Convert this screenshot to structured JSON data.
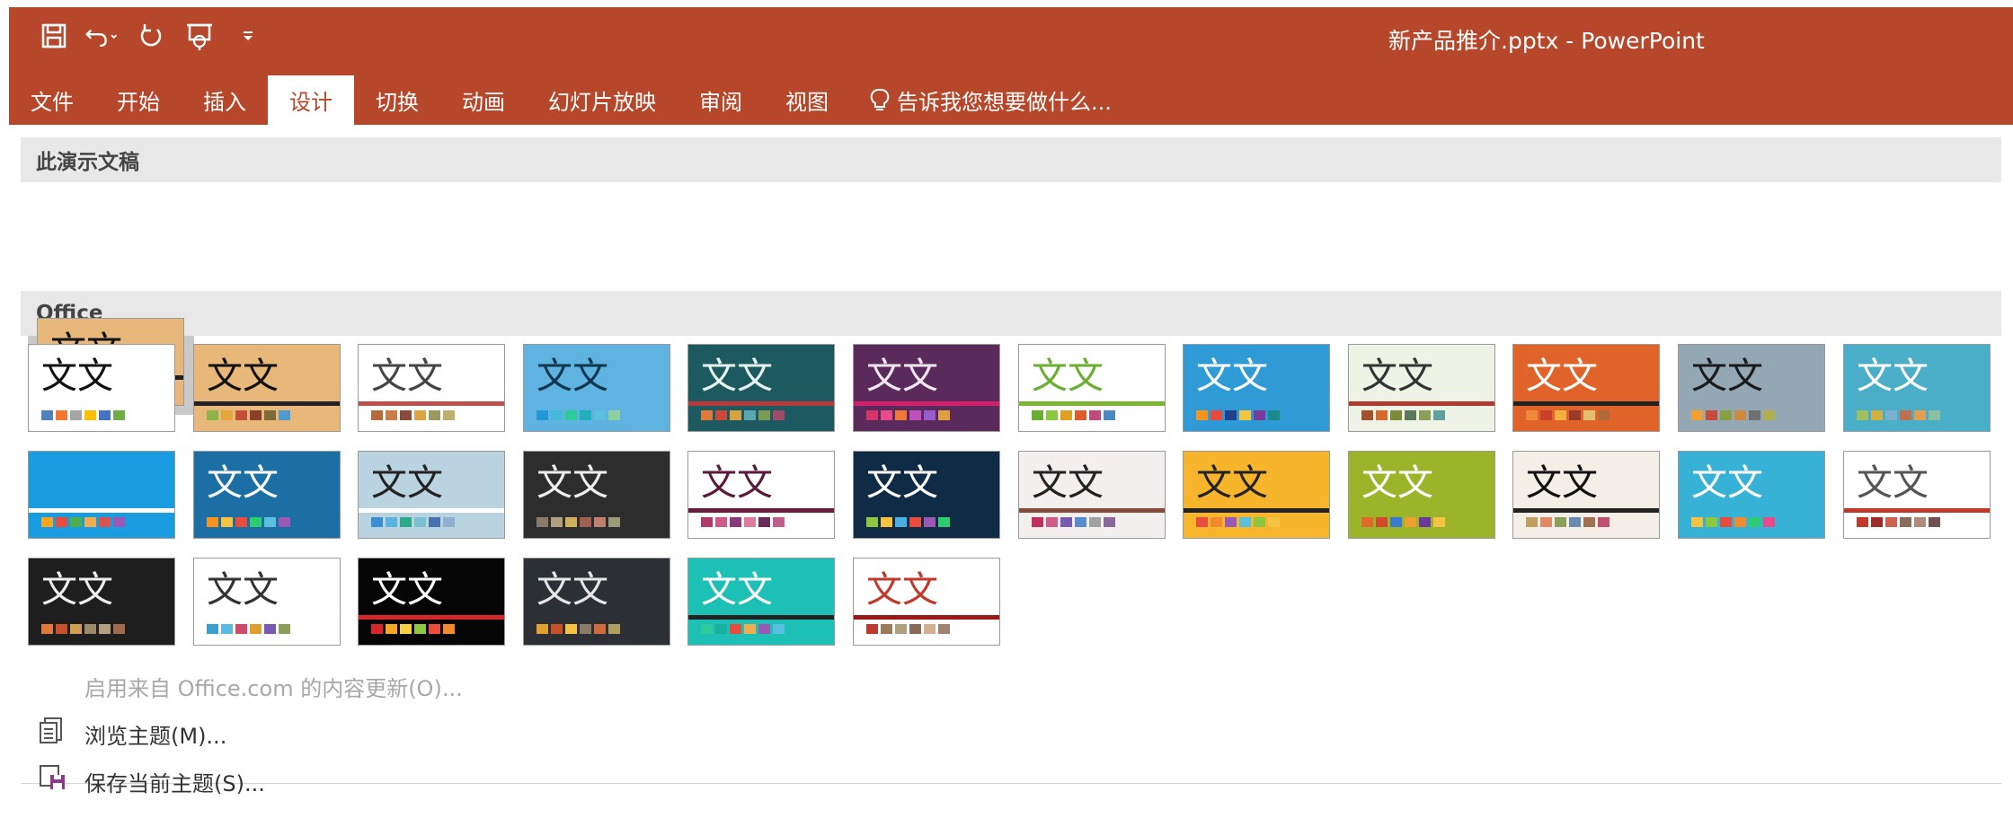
{
  "window": {
    "title": "新产品推介.pptx - PowerPoint"
  },
  "quick_access": [
    {
      "name": "save-icon"
    },
    {
      "name": "undo-icon"
    },
    {
      "name": "redo-icon"
    },
    {
      "name": "presentation-icon"
    },
    {
      "name": "customize-qat-icon"
    }
  ],
  "tabs": [
    {
      "label": "文件",
      "active": false
    },
    {
      "label": "开始",
      "active": false
    },
    {
      "label": "插入",
      "active": false
    },
    {
      "label": "设计",
      "active": true
    },
    {
      "label": "切换",
      "active": false
    },
    {
      "label": "动画",
      "active": false
    },
    {
      "label": "幻灯片放映",
      "active": false
    },
    {
      "label": "审阅",
      "active": false
    },
    {
      "label": "视图",
      "active": false
    }
  ],
  "tell_me": {
    "label": "告诉我您想要做什么..."
  },
  "sections": {
    "this_presentation": "此演示文稿",
    "office": "Office"
  },
  "thumb_text": "文文",
  "current_theme": {
    "text": "文文",
    "bg": "#e8b87a",
    "fg": "#111111",
    "bar": "#222222",
    "swatches": [
      "#8db34a",
      "#e2a63a",
      "#e0c53a",
      "#c2497f",
      "#8a67b0",
      "#4d9bd1",
      "#8fb05a"
    ]
  },
  "themes": [
    {
      "bg": "#ffffff",
      "fg": "#111111",
      "bar": "",
      "swatches": [
        "#4f81bd",
        "#f07830",
        "#a5a5a5",
        "#ffc000",
        "#4472c4",
        "#70ad47"
      ]
    },
    {
      "bg": "#e8b87a",
      "fg": "#111111",
      "bar": "#222222",
      "swatches": [
        "#8db34a",
        "#e2a63a",
        "#c24f38",
        "#8a3f2a",
        "#7f6b3a",
        "#4d9bd1"
      ]
    },
    {
      "bg": "#ffffff",
      "fg": "#444444",
      "bar": "#c0504d",
      "swatches": [
        "#b66a3a",
        "#c97e4a",
        "#8a4a3a",
        "#d9a441",
        "#9a9a60",
        "#c0b070"
      ]
    },
    {
      "bg": "#5fb3e0",
      "fg": "#10354f",
      "bar": "",
      "swatches": [
        "#1f9ad6",
        "#46b9d8",
        "#2ecc9a",
        "#1fb0c0",
        "#5bc0de",
        "#8fd0a0"
      ]
    },
    {
      "bg": "#1d5a5f",
      "fg": "#e8f3f3",
      "bar": "#b83a3a",
      "swatches": [
        "#e07a3a",
        "#c94a3a",
        "#d9a241",
        "#5aa6b0",
        "#7d9a55",
        "#a04a6a"
      ]
    },
    {
      "bg": "#5a2a5a",
      "fg": "#f2e6f2",
      "bar": "#d0206a",
      "swatches": [
        "#d6336a",
        "#e84a8a",
        "#f07838",
        "#c050c0",
        "#9a5ad0",
        "#e0a040"
      ]
    },
    {
      "bg": "#ffffff",
      "fg": "#6aae32",
      "bar": "#7bb531",
      "swatches": [
        "#6aae32",
        "#8dc63f",
        "#e0a020",
        "#e05a2a",
        "#c04a7a",
        "#4a8ac0"
      ]
    },
    {
      "bg": "#2e9ad6",
      "fg": "#ffffff",
      "bar": "",
      "swatches": [
        "#f7941d",
        "#e94a3a",
        "#23408e",
        "#f5c542",
        "#7a3a9a",
        "#1a8a8a"
      ]
    },
    {
      "bg": "#eef3e6",
      "fg": "#333333",
      "bar": "#b03a2e",
      "swatches": [
        "#a3502c",
        "#d46b2a",
        "#7d8a3a",
        "#5a7a5a",
        "#8aa05a",
        "#60a0a0"
      ]
    },
    {
      "bg": "#e0632a",
      "fg": "#ffffff",
      "bar": "#222222",
      "swatches": [
        "#f08a3a",
        "#c8402a",
        "#f5b042",
        "#9a3a2a",
        "#e0c070",
        "#b06a3a"
      ]
    },
    {
      "bg": "#93a8b4",
      "fg": "#1a1a1a",
      "bar": "",
      "swatches": [
        "#f0a030",
        "#c84a3a",
        "#8aa040",
        "#d08a40",
        "#707070",
        "#b0b050"
      ]
    },
    {
      "bg": "#4aaec8",
      "fg": "#ffffff",
      "bar": "",
      "swatches": [
        "#a0c060",
        "#d0b040",
        "#7ab0d0",
        "#c07050",
        "#e0a050",
        "#8ac0a0"
      ]
    },
    {
      "bg": "#1a9ce0",
      "fg": "#1a9ce0",
      "bar": "#ffffff",
      "swatches": [
        "#f5a623",
        "#e94b3c",
        "#4cae4c",
        "#f0ad4e",
        "#d9534f",
        "#9b59b6"
      ]
    },
    {
      "bg": "#1b6fa5",
      "fg": "#ffffff",
      "bar": "",
      "swatches": [
        "#f7941d",
        "#f5c342",
        "#e94b3c",
        "#2ecc71",
        "#5bc0de",
        "#9b59b6"
      ]
    },
    {
      "bg": "#b9d3e0",
      "fg": "#222222",
      "bar": "#ffffff",
      "swatches": [
        "#3a8fd0",
        "#5ab3e0",
        "#2eaa8a",
        "#7ac0d0",
        "#4a70b0",
        "#90b0d0"
      ]
    },
    {
      "bg": "#2d2d2d",
      "fg": "#eeeeee",
      "bar": "",
      "swatches": [
        "#8a7a6a",
        "#b0a080",
        "#d0b060",
        "#a06050",
        "#c08070",
        "#9a9a7a"
      ]
    },
    {
      "bg": "#ffffff",
      "fg": "#5a1a3a",
      "bar": "#6a1e3e",
      "swatches": [
        "#b03a6a",
        "#d05a8a",
        "#8a3a7a",
        "#e07aa0",
        "#6a2a5a",
        "#c0608a"
      ]
    },
    {
      "bg": "#0f2b45",
      "fg": "#ffffff",
      "bar": "",
      "swatches": [
        "#8dc63f",
        "#f5c342",
        "#4ab0e0",
        "#e94b3c",
        "#9b59b6",
        "#2ecc71"
      ]
    },
    {
      "bg": "#f2efee",
      "fg": "#222222",
      "bar": "#8a4a3a",
      "swatches": [
        "#c0305a",
        "#d05a8a",
        "#7a5ab0",
        "#5a8ad0",
        "#a0a0a0",
        "#8a6a9a"
      ]
    },
    {
      "bg": "#f7b52b",
      "fg": "#222222",
      "bar": "#222222",
      "swatches": [
        "#e94b3c",
        "#f08a2a",
        "#9b59b6",
        "#5bc0de",
        "#8dc63f",
        "#f5c342"
      ]
    },
    {
      "bg": "#9bb42a",
      "fg": "#ffffff",
      "bar": "",
      "swatches": [
        "#e06a2a",
        "#d04a2a",
        "#3a7ad0",
        "#f0a030",
        "#6a3a9a",
        "#f5c342"
      ]
    },
    {
      "bg": "#f3efe6",
      "fg": "#111111",
      "bar": "#222222",
      "swatches": [
        "#c0a060",
        "#e08a6a",
        "#8aa05a",
        "#6a8ab0",
        "#a07050",
        "#c05070"
      ]
    },
    {
      "bg": "#38b1d6",
      "fg": "#ffffff",
      "bar": "",
      "swatches": [
        "#f5c342",
        "#8dc63f",
        "#e94b3c",
        "#f08a2a",
        "#2ecc71",
        "#e94b8a"
      ]
    },
    {
      "bg": "#ffffff",
      "fg": "#555555",
      "bar": "#c0392b",
      "swatches": [
        "#c0392b",
        "#a02a2a",
        "#d06050",
        "#8a6a5a",
        "#b08a7a",
        "#705050"
      ]
    },
    {
      "bg": "#1e1e1e",
      "fg": "#eeeeee",
      "bar": "",
      "swatches": [
        "#e07a3a",
        "#c8502a",
        "#d0a050",
        "#9a8a6a",
        "#b0a080",
        "#a06a4a"
      ]
    },
    {
      "bg": "#ffffff",
      "fg": "#333333",
      "bar": "",
      "swatches": [
        "#3aa0d0",
        "#5abae0",
        "#d04a6a",
        "#e0a030",
        "#7a5ab0",
        "#8aa05a"
      ]
    },
    {
      "bg": "#050505",
      "fg": "#ffffff",
      "bar": "#d7262b",
      "swatches": [
        "#d7262b",
        "#f5a623",
        "#f5d142",
        "#8dc63f",
        "#e94b3c",
        "#f08a2a"
      ]
    },
    {
      "bg": "#2c2f33",
      "fg": "#e6e6e6",
      "bar": "",
      "swatches": [
        "#e0a030",
        "#c8502a",
        "#f5c342",
        "#8a7a6a",
        "#d06a3a",
        "#b0a060"
      ]
    },
    {
      "bg": "#1cc0b4",
      "fg": "#ffffff",
      "bar": "#222222",
      "swatches": [
        "#2ecc9a",
        "#1ab0a0",
        "#e94b3c",
        "#f0ad4e",
        "#9b59b6",
        "#5bc0de"
      ]
    },
    {
      "bg": "#ffffff",
      "fg": "#c0392b",
      "bar": "#9a1a1a",
      "swatches": [
        "#c0392b",
        "#9a7a5a",
        "#b0a080",
        "#8a6a5a",
        "#d0b090",
        "#a08070"
      ]
    }
  ],
  "menu": {
    "enable_updates": "启用来自 Office.com 的内容更新(O)...",
    "browse": "浏览主题(M)...",
    "save_current": "保存当前主题(S)..."
  }
}
